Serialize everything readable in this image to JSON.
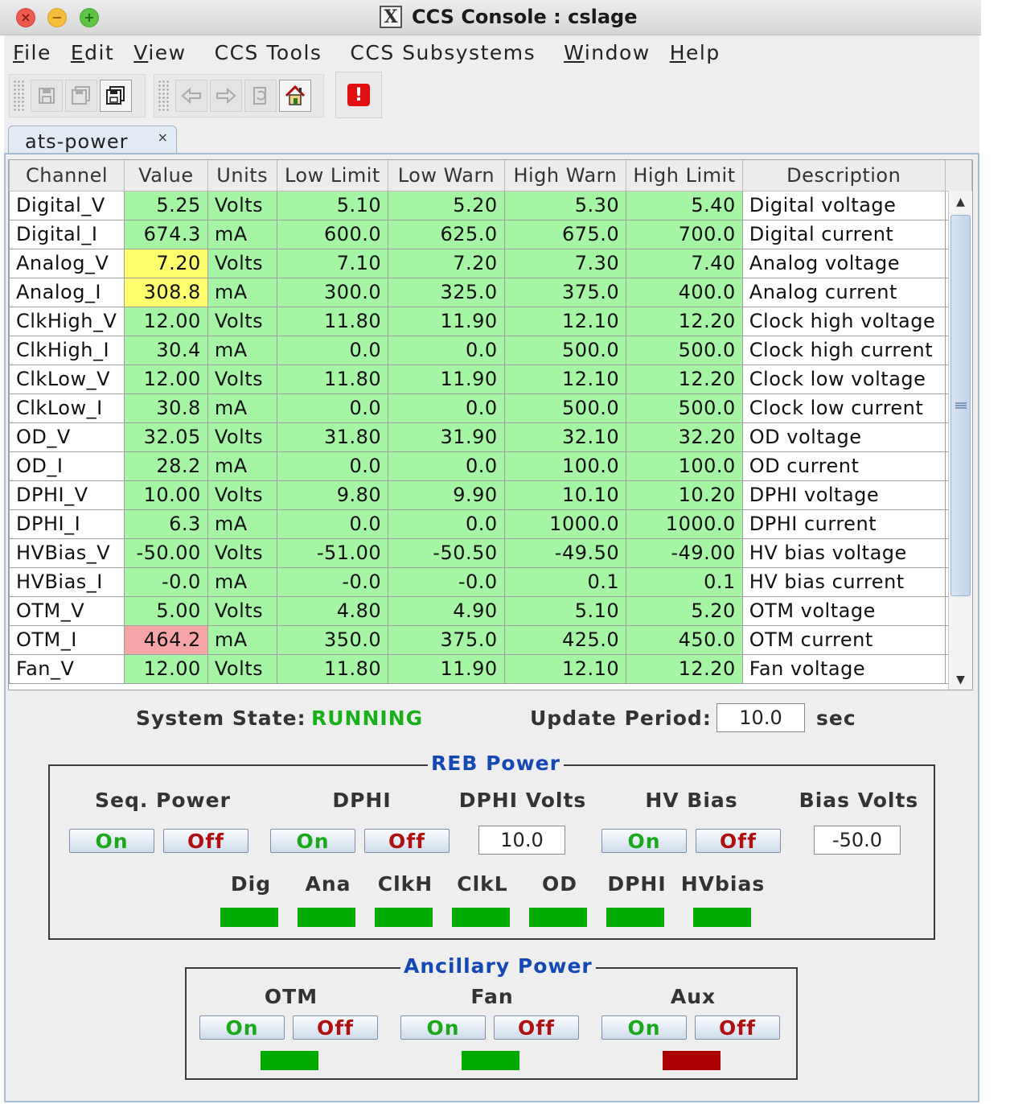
{
  "window": {
    "title": "CCS Console : cslage",
    "x_logo": "X"
  },
  "menu": [
    {
      "pre": "",
      "u": "F",
      "post": "ile"
    },
    {
      "pre": "",
      "u": "E",
      "post": "dit"
    },
    {
      "pre": "",
      "u": "V",
      "post": "iew"
    },
    {
      "pre": "CCS Tools",
      "u": "",
      "post": ""
    },
    {
      "pre": "CCS Subsystems",
      "u": "",
      "post": ""
    },
    {
      "pre": "",
      "u": "W",
      "post": "indow"
    },
    {
      "pre": "",
      "u": "H",
      "post": "elp"
    }
  ],
  "tab": {
    "label": "ats-power",
    "close": "×"
  },
  "table": {
    "headers": [
      "Channel",
      "Value",
      "Units",
      "Low Limit",
      "Low Warn",
      "High Warn",
      "High Limit",
      "Description"
    ],
    "rows": [
      {
        "channel": "Digital_V",
        "value": "5.25",
        "state": "ok",
        "units": "Volts",
        "low_limit": "5.10",
        "low_warn": "5.20",
        "high_warn": "5.30",
        "high_limit": "5.40",
        "description": "Digital voltage"
      },
      {
        "channel": "Digital_I",
        "value": "674.3",
        "state": "ok",
        "units": "mA",
        "low_limit": "600.0",
        "low_warn": "625.0",
        "high_warn": "675.0",
        "high_limit": "700.0",
        "description": "Digital current"
      },
      {
        "channel": "Analog_V",
        "value": "7.20",
        "state": "warn",
        "units": "Volts",
        "low_limit": "7.10",
        "low_warn": "7.20",
        "high_warn": "7.30",
        "high_limit": "7.40",
        "description": "Analog voltage"
      },
      {
        "channel": "Analog_I",
        "value": "308.8",
        "state": "warn",
        "units": "mA",
        "low_limit": "300.0",
        "low_warn": "325.0",
        "high_warn": "375.0",
        "high_limit": "400.0",
        "description": "Analog current"
      },
      {
        "channel": "ClkHigh_V",
        "value": "12.00",
        "state": "ok",
        "units": "Volts",
        "low_limit": "11.80",
        "low_warn": "11.90",
        "high_warn": "12.10",
        "high_limit": "12.20",
        "description": "Clock high voltage"
      },
      {
        "channel": "ClkHigh_I",
        "value": "30.4",
        "state": "ok",
        "units": "mA",
        "low_limit": "0.0",
        "low_warn": "0.0",
        "high_warn": "500.0",
        "high_limit": "500.0",
        "description": "Clock high current"
      },
      {
        "channel": "ClkLow_V",
        "value": "12.00",
        "state": "ok",
        "units": "Volts",
        "low_limit": "11.80",
        "low_warn": "11.90",
        "high_warn": "12.10",
        "high_limit": "12.20",
        "description": "Clock low voltage"
      },
      {
        "channel": "ClkLow_I",
        "value": "30.8",
        "state": "ok",
        "units": "mA",
        "low_limit": "0.0",
        "low_warn": "0.0",
        "high_warn": "500.0",
        "high_limit": "500.0",
        "description": "Clock low current"
      },
      {
        "channel": "OD_V",
        "value": "32.05",
        "state": "ok",
        "units": "Volts",
        "low_limit": "31.80",
        "low_warn": "31.90",
        "high_warn": "32.10",
        "high_limit": "32.20",
        "description": "OD voltage"
      },
      {
        "channel": "OD_I",
        "value": "28.2",
        "state": "ok",
        "units": "mA",
        "low_limit": "0.0",
        "low_warn": "0.0",
        "high_warn": "100.0",
        "high_limit": "100.0",
        "description": "OD current"
      },
      {
        "channel": "DPHI_V",
        "value": "10.00",
        "state": "ok",
        "units": "Volts",
        "low_limit": "9.80",
        "low_warn": "9.90",
        "high_warn": "10.10",
        "high_limit": "10.20",
        "description": "DPHI voltage"
      },
      {
        "channel": "DPHI_I",
        "value": "6.3",
        "state": "ok",
        "units": "mA",
        "low_limit": "0.0",
        "low_warn": "0.0",
        "high_warn": "1000.0",
        "high_limit": "1000.0",
        "description": "DPHI current"
      },
      {
        "channel": "HVBias_V",
        "value": "-50.00",
        "state": "ok",
        "units": "Volts",
        "low_limit": "-51.00",
        "low_warn": "-50.50",
        "high_warn": "-49.50",
        "high_limit": "-49.00",
        "description": "HV bias voltage"
      },
      {
        "channel": "HVBias_I",
        "value": "-0.0",
        "state": "ok",
        "units": "mA",
        "low_limit": "-0.0",
        "low_warn": "-0.0",
        "high_warn": "0.1",
        "high_limit": "0.1",
        "description": "HV bias current"
      },
      {
        "channel": "OTM_V",
        "value": "5.00",
        "state": "ok",
        "units": "Volts",
        "low_limit": "4.80",
        "low_warn": "4.90",
        "high_warn": "5.10",
        "high_limit": "5.20",
        "description": "OTM voltage"
      },
      {
        "channel": "OTM_I",
        "value": "464.2",
        "state": "alarm",
        "units": "mA",
        "low_limit": "350.0",
        "low_warn": "375.0",
        "high_warn": "425.0",
        "high_limit": "450.0",
        "description": "OTM current"
      },
      {
        "channel": "Fan_V",
        "value": "12.00",
        "state": "ok",
        "units": "Volts",
        "low_limit": "11.80",
        "low_warn": "11.90",
        "high_warn": "12.10",
        "high_limit": "12.20",
        "description": "Fan voltage"
      }
    ]
  },
  "status": {
    "system_state_label": "System State:",
    "system_state_value": "RUNNING",
    "update_period_label": "Update Period:",
    "update_period_value": "10.0",
    "update_period_unit": "sec"
  },
  "reb_power": {
    "title": "REB Power",
    "seq_power_label": "Seq. Power",
    "dphi_label": "DPHI",
    "dphi_volts_label": "DPHI Volts",
    "dphi_volts_value": "10.0",
    "hv_bias_label": "HV Bias",
    "bias_volts_label": "Bias Volts",
    "bias_volts_value": "-50.0",
    "on_label": "On",
    "off_label": "Off",
    "indicators": [
      {
        "label": "Dig",
        "color": "#00aa00"
      },
      {
        "label": "Ana",
        "color": "#00aa00"
      },
      {
        "label": "ClkH",
        "color": "#00aa00"
      },
      {
        "label": "ClkL",
        "color": "#00aa00"
      },
      {
        "label": "OD",
        "color": "#00aa00"
      },
      {
        "label": "DPHI",
        "color": "#00aa00"
      },
      {
        "label": "HVbias",
        "color": "#00aa00"
      }
    ]
  },
  "ancillary_power": {
    "title": "Ancillary Power",
    "on_label": "On",
    "off_label": "Off",
    "channels": [
      {
        "label": "OTM",
        "color": "#00aa00"
      },
      {
        "label": "Fan",
        "color": "#00aa00"
      },
      {
        "label": "Aux",
        "color": "#aa0000"
      }
    ]
  },
  "colors": {
    "ok": "#a5f5a5",
    "warn": "#ffff6e",
    "alarm": "#f5a5a5",
    "running": "#18b018",
    "group_title": "#1448b4"
  },
  "icons": [
    "close-window-icon",
    "minimize-window-icon",
    "maximize-window-icon",
    "x11-logo-icon",
    "save-icon",
    "save-all-icon",
    "save-as-icon",
    "back-arrow-icon",
    "forward-arrow-icon",
    "refresh-icon",
    "home-icon",
    "alert-icon"
  ]
}
